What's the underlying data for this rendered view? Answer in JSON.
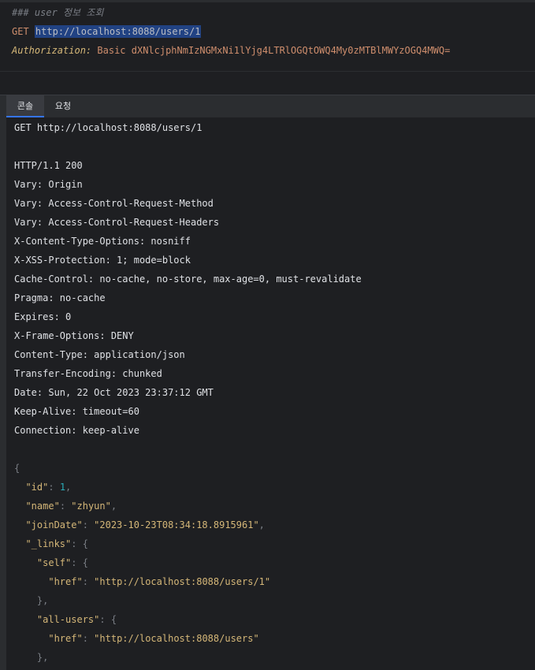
{
  "editor": {
    "comment": "### user 정보 조회",
    "method": "GET",
    "url": "http://localhost:8088/users/1",
    "auth_header_name": "Authorization:",
    "auth_header_value": "Basic dXNlcjphNmIzNGMxNi1lYjg4LTRlOGQtOWQ4My0zMTBlMWYzOGQ4MWQ="
  },
  "tabs": {
    "console": "콘솔",
    "request": "요청"
  },
  "console": {
    "request_line": "GET http://localhost:8088/users/1",
    "status_line": "HTTP/1.1 200",
    "headers": [
      "Vary: Origin",
      "Vary: Access-Control-Request-Method",
      "Vary: Access-Control-Request-Headers",
      "X-Content-Type-Options: nosniff",
      "X-XSS-Protection: 1; mode=block",
      "Cache-Control: no-cache, no-store, max-age=0, must-revalidate",
      "Pragma: no-cache",
      "Expires: 0",
      "X-Frame-Options: DENY",
      "Content-Type: application/json",
      "Transfer-Encoding: chunked",
      "Date: Sun, 22 Oct 2023 23:37:12 GMT",
      "Keep-Alive: timeout=60",
      "Connection: keep-alive"
    ],
    "json": {
      "open_brace": "{",
      "id_key": "\"id\"",
      "id_value": "1",
      "name_key": "\"name\"",
      "name_value": "\"zhyun\"",
      "joinDate_key": "\"joinDate\"",
      "joinDate_value": "\"2023-10-23T08:34:18.8915961\"",
      "links_key": "\"_links\"",
      "self_key": "\"self\"",
      "href_key": "\"href\"",
      "self_href": "\"http://localhost:8088/users/1\"",
      "all_users_key": "\"all-users\"",
      "all_users_href": "\"http://localhost:8088/users\""
    }
  }
}
